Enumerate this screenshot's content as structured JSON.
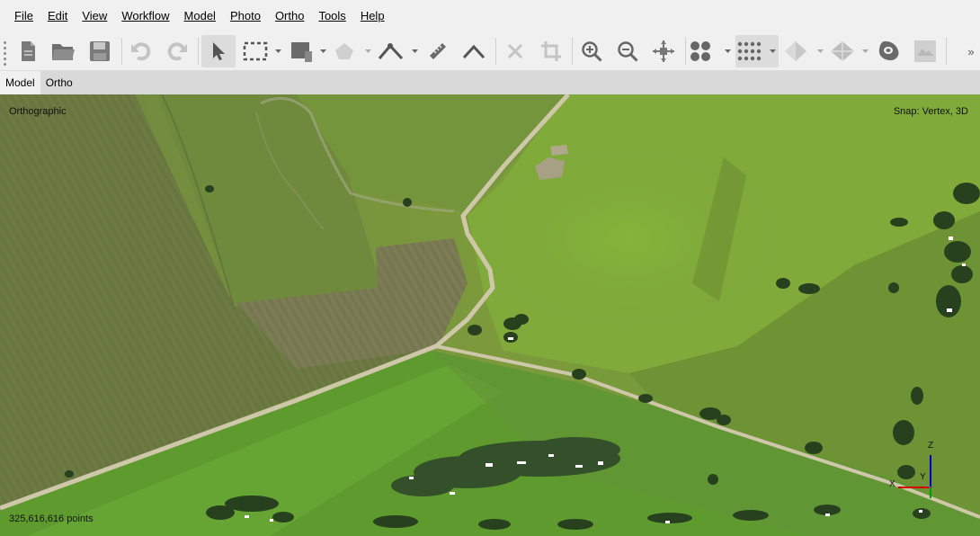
{
  "menu": {
    "items": [
      {
        "label": "File"
      },
      {
        "label": "Edit"
      },
      {
        "label": "View"
      },
      {
        "label": "Workflow"
      },
      {
        "label": "Model"
      },
      {
        "label": "Photo"
      },
      {
        "label": "Ortho"
      },
      {
        "label": "Tools"
      },
      {
        "label": "Help"
      }
    ]
  },
  "toolbar": {
    "overflow_label": "»",
    "icons": [
      "new-project-icon",
      "open-folder-icon",
      "save-icon",
      "undo-icon",
      "redo-icon",
      "navigation-arrow-icon",
      "rectangle-selection-icon",
      "draw-shape-icon",
      "polygon-tool-icon",
      "polyline-tool-icon",
      "ruler-icon",
      "angle-icon",
      "delete-icon",
      "crop-icon",
      "zoom-in-icon",
      "zoom-out-icon",
      "reset-view-icon",
      "point-cloud-icon",
      "dense-cloud-icon",
      "model-solid-icon",
      "model-textured-icon",
      "tiled-model-icon",
      "dem-icon"
    ]
  },
  "tabs": [
    {
      "label": "Model",
      "active": true
    },
    {
      "label": "Ortho",
      "active": false
    }
  ],
  "viewport": {
    "projection_label": "Orthographic",
    "snap_label": "Snap: Vertex, 3D",
    "points_label": "325,616,616 points",
    "axis_labels": {
      "x": "X",
      "y": "Y",
      "z": "Z"
    },
    "colors": {
      "x_axis": "#d40000",
      "y_axis": "#00a000",
      "z_axis": "#0000d0"
    }
  }
}
